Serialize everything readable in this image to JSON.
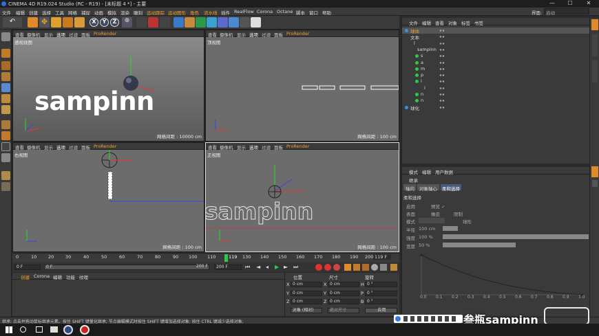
{
  "window": {
    "title": "CINEMA 4D R19.024 Studio (RC - R19) - [未标题 4 *] - 主要",
    "minimize": "—",
    "maximize": "☐",
    "close": "✕"
  },
  "menubar": {
    "items": [
      "文件",
      "编辑",
      "创建",
      "选择",
      "工具",
      "网格",
      "捕捉",
      "动画",
      "模拟",
      "渲染",
      "雕刻",
      "运动跟踪",
      "运动图形",
      "角色",
      "流水线",
      "插件",
      "RealFlow",
      "Corona",
      "Octane",
      "脚本",
      "窗口",
      "帮助"
    ],
    "layout_label": "界面:",
    "layout_value": "启动"
  },
  "viewport_menu": [
    "查看",
    "摄像机",
    "显示",
    "选项",
    "过滤",
    "面板",
    "ProRender"
  ],
  "viewports": {
    "perspective": {
      "label": "透视视图",
      "grid": "网格间距 : 10000 cm"
    },
    "top": {
      "label": "顶视图",
      "grid": "网格间距 : 100 cm"
    },
    "right": {
      "label": "右视图",
      "grid": "网格间距 : 100 cm"
    },
    "front": {
      "label": "正视图",
      "grid": "网格间距 : 100 cm"
    }
  },
  "scene_text": "sampinn",
  "timeline": {
    "ticks": [
      "0",
      "10",
      "20",
      "30",
      "40",
      "50",
      "60",
      "70",
      "80",
      "90",
      "100",
      "110",
      "120",
      "130",
      "140",
      "150",
      "160",
      "170",
      "180",
      "190",
      "200"
    ],
    "current_frame_label": "119",
    "current_frame_value": 119,
    "end_frame": "119 F",
    "start_field": "0 F",
    "range_start": "0 F",
    "range_end": "200 F",
    "max_field": "200 F"
  },
  "material_menu": [
    "创建",
    "Corona",
    "编辑",
    "功能",
    "纹理"
  ],
  "coords": {
    "headers": [
      "位置",
      "尺寸",
      "旋转"
    ],
    "rows": [
      {
        "axis": "X",
        "pos": "0 cm",
        "size": "0 cm",
        "rot_label": "H",
        "rot": "0 °"
      },
      {
        "axis": "Y",
        "pos": "0 cm",
        "size": "0 cm",
        "rot_label": "P",
        "rot": "0 °"
      },
      {
        "axis": "Z",
        "pos": "0 cm",
        "size": "0 cm",
        "rot_label": "B",
        "rot": "0 °"
      }
    ],
    "mode": "对象 (相对)",
    "size_mode": "绝对尺寸",
    "apply": "应用"
  },
  "object_manager": {
    "menu": [
      "文件",
      "编辑",
      "查看",
      "对象",
      "标签",
      "书签"
    ],
    "objects": [
      {
        "name": "球体",
        "indent": 0,
        "dot": "blue"
      },
      {
        "name": "文本",
        "indent": 0,
        "dot": "none"
      },
      {
        "name": "l",
        "indent": 1,
        "dot": "none"
      },
      {
        "name": "sampinn",
        "indent": 2,
        "dot": "none"
      },
      {
        "name": "s",
        "indent": 3,
        "dot": "green"
      },
      {
        "name": "a",
        "indent": 3,
        "dot": "green"
      },
      {
        "name": "m",
        "indent": 3,
        "dot": "green"
      },
      {
        "name": "p",
        "indent": 3,
        "dot": "green"
      },
      {
        "name": "i",
        "indent": 3,
        "dot": "green"
      },
      {
        "name": "i",
        "indent": 4,
        "dot": "none"
      },
      {
        "name": "n",
        "indent": 3,
        "dot": "green"
      },
      {
        "name": "n",
        "indent": 3,
        "dot": "green"
      },
      {
        "name": "球化",
        "indent": 0,
        "dot": "blue"
      }
    ]
  },
  "attribute_manager": {
    "menu": [
      "模式",
      "编辑",
      "用户数据"
    ],
    "object_title": "继承",
    "tabs": [
      "轴向",
      "对象轴心",
      "柔和选择"
    ],
    "section": "柔和选择",
    "rows": [
      {
        "label": "启用",
        "value": "预览 ✓"
      },
      {
        "label": "表面",
        "value": "橡皮"
      },
      {
        "label": "限制",
        "value": ""
      },
      {
        "label": "模式",
        "value": "球形"
      },
      {
        "label": "半径",
        "value": "100 cm"
      },
      {
        "label": "强度",
        "value": "100 %"
      },
      {
        "label": "宽度",
        "value": "50 %"
      }
    ],
    "graph_axis": [
      "0.0",
      "0.1",
      "0.2",
      "0.3",
      "0.4",
      "0.5",
      "0.6",
      "0.7",
      "0.8",
      "0.9",
      "1.0"
    ]
  },
  "status_text": "继承: 点击并拖动鼠标继承元素。按住 SHIFT 键量化继承; 节点编辑模式时按住 SHIFT 键增加选择对象; 按住 CTRL 键减少选择对象;",
  "watermark": "叁瓶sampinn",
  "colors": {
    "accent": "#f0a030",
    "green_dot": "#2ec84a",
    "blue_dot": "#3a8ee6",
    "axis_green": "#22dd22",
    "axis_red": "#ee3333",
    "axis_blue": "#3344ee"
  }
}
